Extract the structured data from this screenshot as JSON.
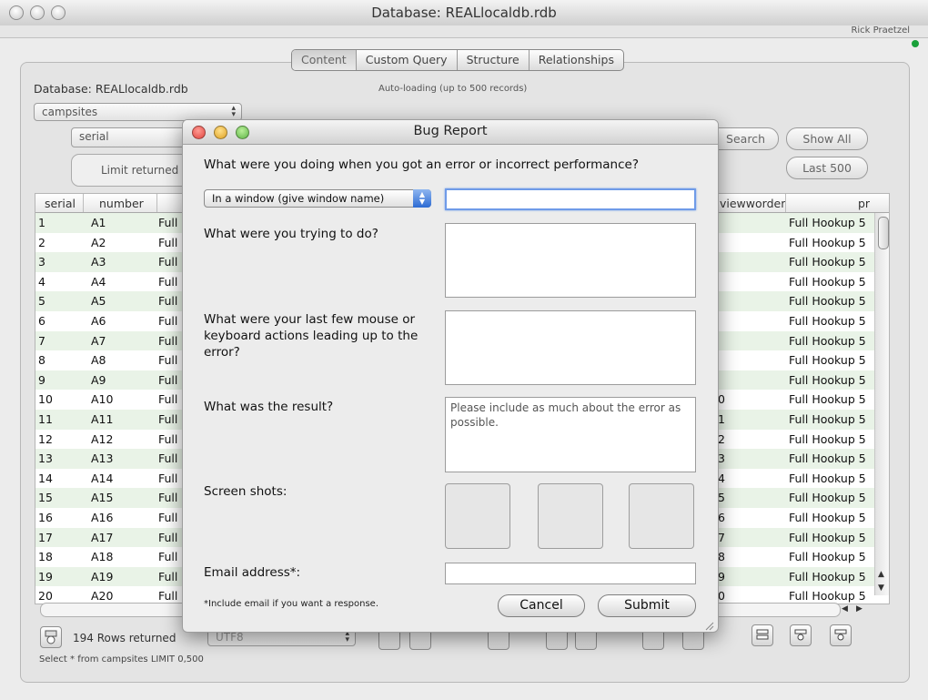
{
  "window": {
    "title": "Database: REALlocaldb.rdb",
    "user": "Rick Praetzel"
  },
  "tabs": [
    "Content",
    "Custom Query",
    "Structure",
    "Relationships"
  ],
  "panel": {
    "db_label": "Database: REALlocaldb.rdb",
    "autoload": "Auto-loading (up to 500 records)",
    "table_select": "campsites",
    "field_select": "serial",
    "limit_label": "Limit returned",
    "search_label": "Search",
    "show_all_label": "Show All",
    "last_500_label": "Last 500"
  },
  "table": {
    "headers": [
      "serial",
      "number",
      "viewworder",
      "pr"
    ],
    "rows": [
      {
        "serial": "1",
        "number": "A1",
        "c3": "Full",
        "view": "",
        "pr": "Full Hookup 5"
      },
      {
        "serial": "2",
        "number": "A2",
        "c3": "Full",
        "view": "",
        "pr": "Full Hookup 5"
      },
      {
        "serial": "3",
        "number": "A3",
        "c3": "Full",
        "view": "",
        "pr": "Full Hookup 5"
      },
      {
        "serial": "4",
        "number": "A4",
        "c3": "Full",
        "view": "",
        "pr": "Full Hookup 5"
      },
      {
        "serial": "5",
        "number": "A5",
        "c3": "Full",
        "view": "",
        "pr": "Full Hookup 5"
      },
      {
        "serial": "6",
        "number": "A6",
        "c3": "Full",
        "view": "",
        "pr": "Full Hookup 5"
      },
      {
        "serial": "7",
        "number": "A7",
        "c3": "Full",
        "view": "",
        "pr": "Full Hookup 5"
      },
      {
        "serial": "8",
        "number": "A8",
        "c3": "Full",
        "view": "",
        "pr": "Full Hookup 5"
      },
      {
        "serial": "9",
        "number": "A9",
        "c3": "Full",
        "view": "",
        "pr": "Full Hookup 5"
      },
      {
        "serial": "10",
        "number": "A10",
        "c3": "Full",
        "view": "0",
        "pr": "Full Hookup 5"
      },
      {
        "serial": "11",
        "number": "A11",
        "c3": "Full",
        "view": "1",
        "pr": "Full Hookup 5"
      },
      {
        "serial": "12",
        "number": "A12",
        "c3": "Full",
        "view": "2",
        "pr": "Full Hookup 5"
      },
      {
        "serial": "13",
        "number": "A13",
        "c3": "Full",
        "view": "3",
        "pr": "Full Hookup 5"
      },
      {
        "serial": "14",
        "number": "A14",
        "c3": "Full",
        "view": "4",
        "pr": "Full Hookup 5"
      },
      {
        "serial": "15",
        "number": "A15",
        "c3": "Full",
        "view": "5",
        "pr": "Full Hookup 5"
      },
      {
        "serial": "16",
        "number": "A16",
        "c3": "Full",
        "view": "6",
        "pr": "Full Hookup 5"
      },
      {
        "serial": "17",
        "number": "A17",
        "c3": "Full",
        "view": "7",
        "pr": "Full Hookup 5"
      },
      {
        "serial": "18",
        "number": "A18",
        "c3": "Full",
        "view": "8",
        "pr": "Full Hookup 5"
      },
      {
        "serial": "19",
        "number": "A19",
        "c3": "Full",
        "view": "9",
        "pr": "Full Hookup 5"
      },
      {
        "serial": "20",
        "number": "A20",
        "c3": "Full",
        "view": "0",
        "pr": "Full Hookup 5"
      }
    ]
  },
  "status": {
    "rows_returned": "194 Rows returned",
    "encoding": "UTF8",
    "query": "Select * from campsites LIMIT 0,500"
  },
  "dialog": {
    "title": "Bug Report",
    "q_doing": "What were you doing when you got an error or incorrect performance?",
    "context_select": "In a window (give window name)",
    "window_name_value": "",
    "q_trying": "What were you trying to do?",
    "q_actions": "What were your last few mouse or keyboard actions leading up to the error?",
    "q_result": "What was the result?",
    "result_placeholder": "Please include as much about the error as possible.",
    "screenshots_label": "Screen shots:",
    "email_label": "Email address*:",
    "email_value": "",
    "footnote": "*Include email if you want a response.",
    "cancel_label": "Cancel",
    "submit_label": "Submit"
  },
  "icons": {
    "window_close": "close-dot-icon",
    "dialog_lights": [
      "red-close-icon",
      "yellow-minimize-icon",
      "green-zoom-icon"
    ],
    "colors": {
      "row_alt": "#e9f3e7",
      "focus_ring": "#6f9be8",
      "light_red": "#e0443e",
      "light_yellow": "#dea123",
      "light_green": "#5db445"
    }
  }
}
